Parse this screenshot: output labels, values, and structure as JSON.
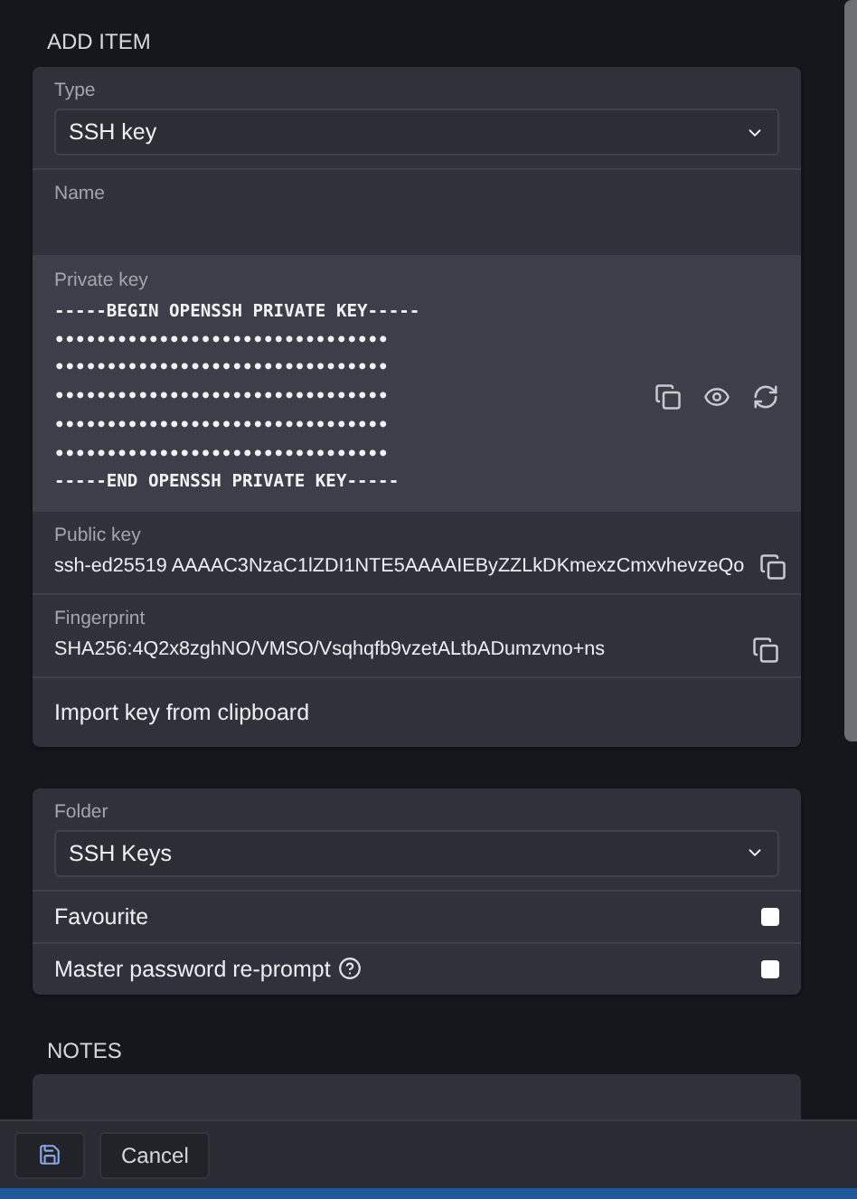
{
  "heading": "ADD ITEM",
  "item_fields": [
    {
      "kind": "select",
      "label": "Type",
      "value": "SSH key"
    },
    {
      "kind": "text",
      "label": "Name"
    },
    {
      "kind": "secret",
      "label": "Private key",
      "lines": [
        "-----BEGIN OPENSSH PRIVATE KEY-----",
        "••••••••••••••••••••••••••••••••",
        "••••••••••••••••••••••••••••••••",
        "••••••••••••••••••••••••••••••••",
        "••••••••••••••••••••••••••••••••",
        "••••••••••••••••••••••••••••••••",
        "-----END OPENSSH PRIVATE KEY-----"
      ]
    },
    {
      "kind": "copy",
      "label": "Public key",
      "value": "ssh-ed25519 AAAAC3NzaC1lZDI1NTE5AAAAIEByZZLkDKmexzCmxvhevzeQo"
    },
    {
      "kind": "copy",
      "label": "Fingerprint",
      "value": "SHA256:4Q2x8zghNO/VMSO/Vsqhqfb9vzetALtbADumzvno+ns"
    },
    {
      "kind": "action",
      "label": "Import key from clipboard"
    }
  ],
  "options": [
    {
      "kind": "select",
      "label": "Folder",
      "value": "SSH Keys"
    },
    {
      "kind": "checkbox",
      "label": "Favourite",
      "checked": false,
      "help": false
    },
    {
      "kind": "checkbox",
      "label": "Master password re-prompt",
      "checked": false,
      "help": true
    }
  ],
  "notes": {
    "heading": "NOTES"
  },
  "footer": {
    "cancel": "Cancel"
  }
}
